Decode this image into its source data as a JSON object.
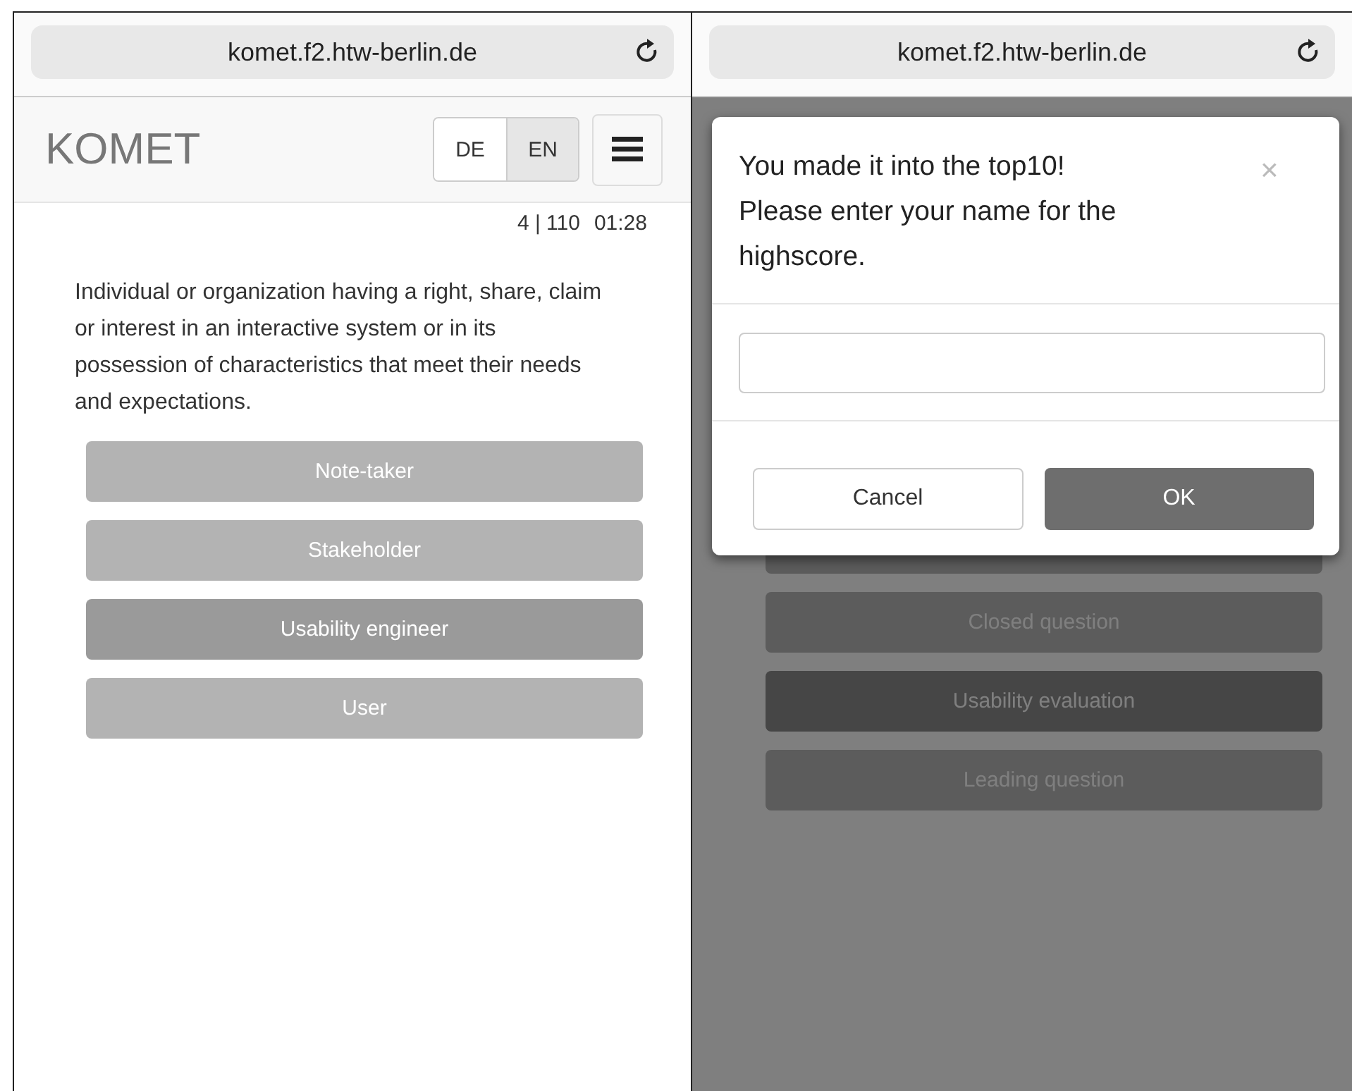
{
  "screens": [
    {
      "url": "komet.f2.htw-berlin.de",
      "dimmed": false,
      "logo": "KOMET",
      "languages": [
        {
          "label": "DE",
          "selected": false
        },
        {
          "label": "EN",
          "selected": true
        }
      ],
      "progress": "4 | 110",
      "timer": "01:28",
      "question": "Individual or organization having a right, share, claim or interest in an interactive system or in its possession of characteristics that meet their needs and expectations.",
      "answers": [
        {
          "label": "Note-taker",
          "selected": false
        },
        {
          "label": "Stakeholder",
          "selected": false
        },
        {
          "label": "Usability engineer",
          "selected": true
        },
        {
          "label": "User",
          "selected": false
        }
      ]
    },
    {
      "url": "komet.f2.htw-berlin.de",
      "dimmed": true,
      "answers": [
        {
          "selected": false
        },
        {
          "label": "Closed question",
          "selected": false
        },
        {
          "label": "Usability evaluation",
          "selected": true
        },
        {
          "label": "Leading question",
          "selected": false
        }
      ],
      "dialog": {
        "title": "You made it into the top10!\nPlease enter your name for the highscore.",
        "close": "×",
        "buttons": [
          {
            "label": "Cancel",
            "kind": "secondary"
          },
          {
            "label": "OK",
            "kind": "primary"
          }
        ]
      }
    }
  ]
}
